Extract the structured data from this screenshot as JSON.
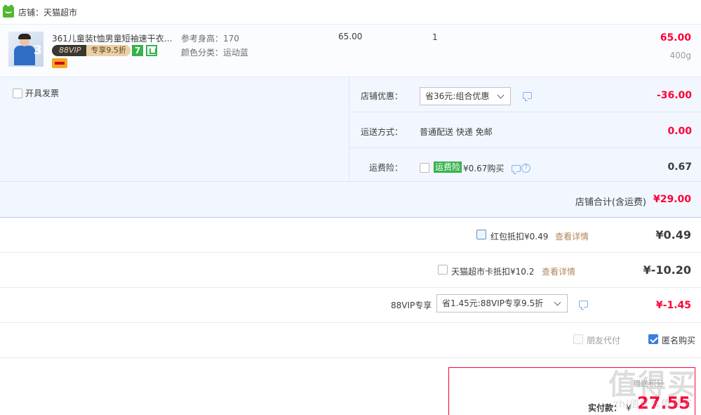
{
  "shop": {
    "label": "店铺：天猫超市",
    "icon": "tmall-icon"
  },
  "item": {
    "title": "361儿童装t恤男童短袖速干衣2...",
    "vip_left": "88VIP",
    "vip_right": "专享9.5折",
    "tag_number": "7",
    "attr_height": "参考身高：170",
    "attr_color": "颜色分类：运动蓝",
    "unit_price": "65.00",
    "quantity": "1",
    "total": "65.00",
    "weight": "400g"
  },
  "invoice": {
    "label": "开具发票"
  },
  "options": {
    "coupon_label": "店铺优惠：",
    "coupon_value": "省36元:组合优惠",
    "coupon_amount": "-36.00",
    "delivery_label": "运送方式：",
    "delivery_value": "普通配送 快递 免邮",
    "delivery_amount": "0.00",
    "insurance_label": "运费险：",
    "insurance_tag": "运费险",
    "insurance_price": "¥0.67购买",
    "insurance_amount": "0.67"
  },
  "shop_total": {
    "label": "店铺合计(含运费)",
    "value": "¥29.00"
  },
  "redpacket": {
    "label": "红包抵扣¥0.49",
    "link": "查看详情",
    "value": "¥0.49"
  },
  "tmall_card": {
    "label": "天猫超市卡抵扣¥10.2",
    "link": "查看详情",
    "value": "¥-10.20"
  },
  "vip": {
    "label": "88VIP专享",
    "value": "省1.45元:88VIP专享9.5折",
    "amount": "¥-1.45"
  },
  "friend_pay": {
    "label": "朋友代付"
  },
  "anonymous": {
    "label": "匿名购买"
  },
  "final": {
    "hint": "赠送积分",
    "label": "实付款：",
    "currency": "¥",
    "amount": "27.55"
  },
  "watermark": {
    "main": "值得买",
    "sub": "zhi值什么值得买"
  },
  "colors": {
    "price_red": "#ff0036",
    "link_gold": "#b0875a",
    "panel_blue": "#f2f7ff",
    "tmall_green": "#4fb82f"
  }
}
